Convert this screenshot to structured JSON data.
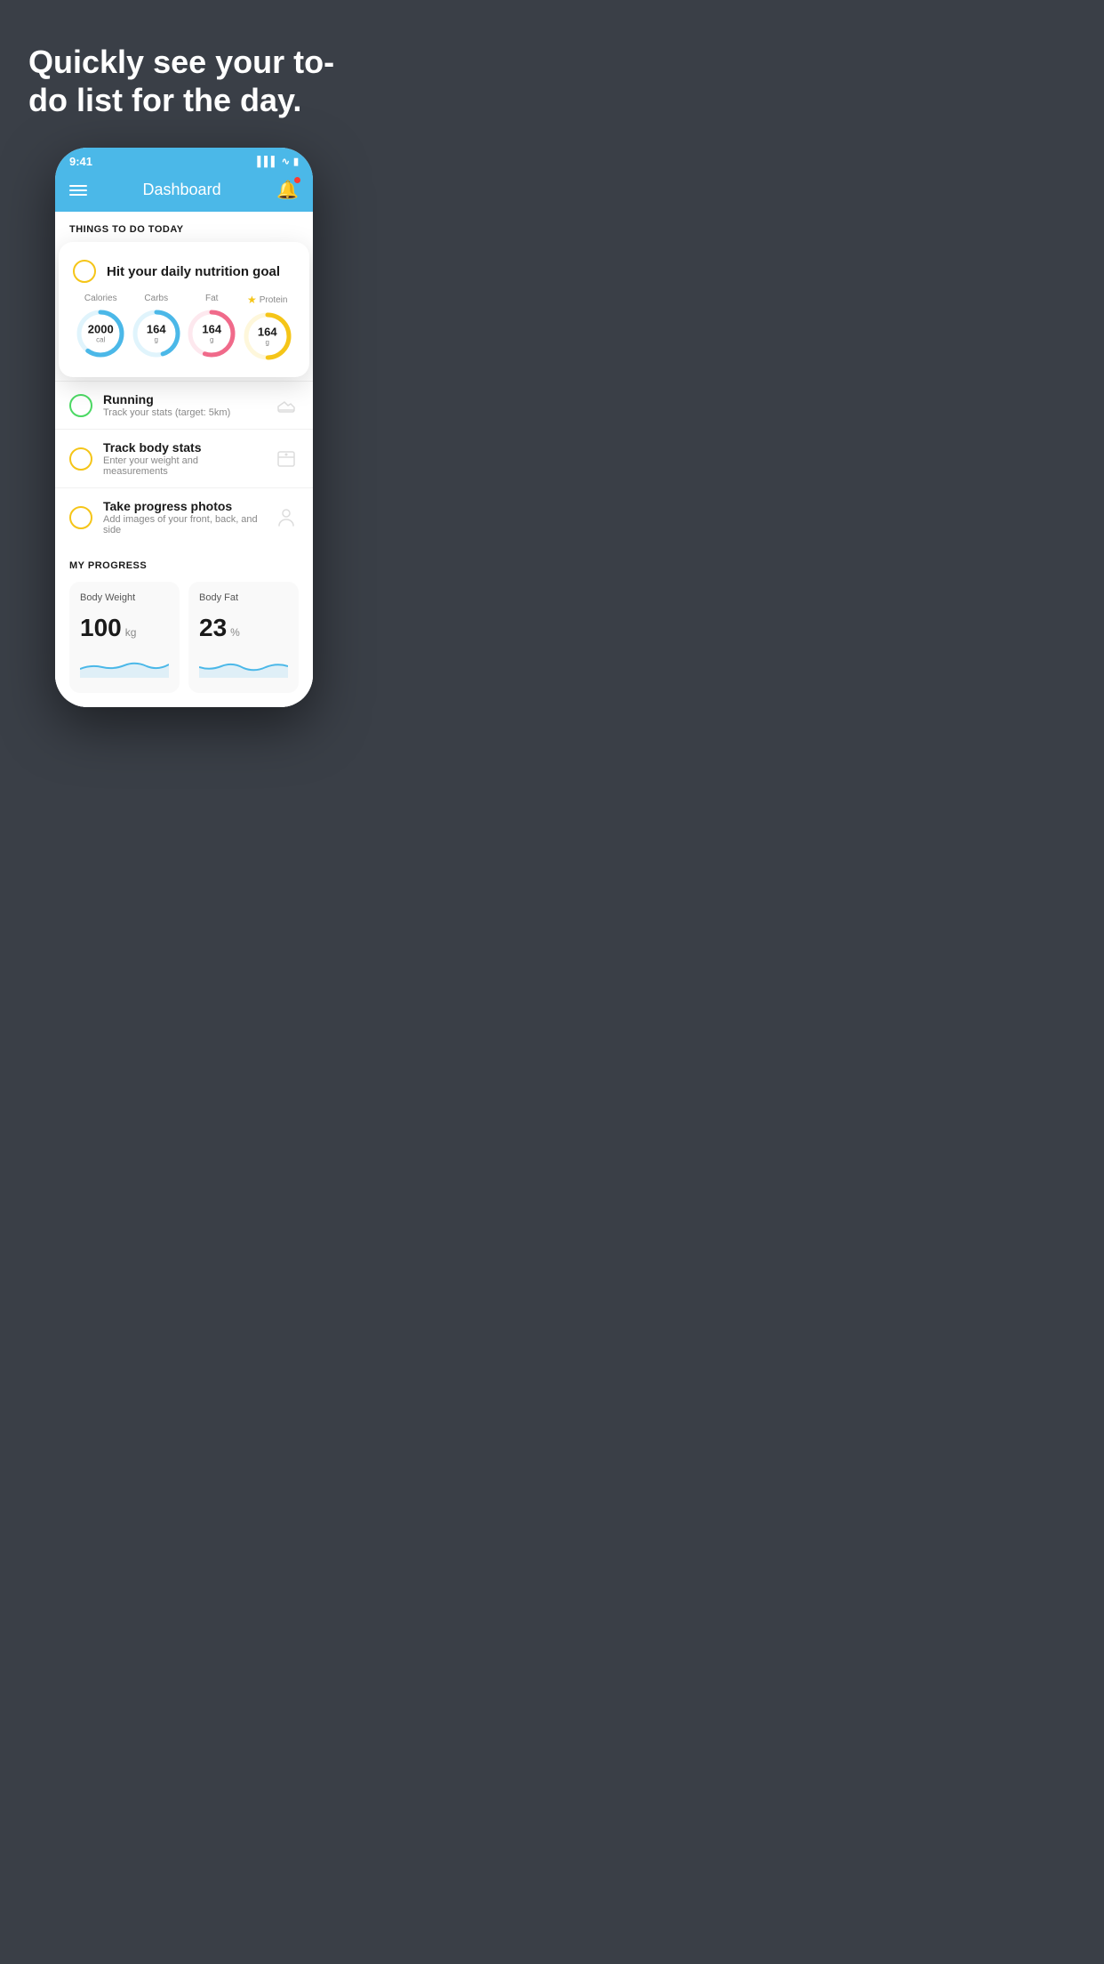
{
  "hero": {
    "title": "Quickly see your to-do list for the day."
  },
  "phone": {
    "status_bar": {
      "time": "9:41",
      "signal_icon": "signal-icon",
      "wifi_icon": "wifi-icon",
      "battery_icon": "battery-icon"
    },
    "nav": {
      "title": "Dashboard",
      "menu_icon": "menu-icon",
      "bell_icon": "bell-icon"
    },
    "things_section": {
      "header": "THINGS TO DO TODAY"
    },
    "nutrition_card": {
      "checkbox_state": "incomplete",
      "title": "Hit your daily nutrition goal",
      "metrics": [
        {
          "label": "Calories",
          "value": "2000",
          "unit": "cal",
          "color": "#4bb8e8",
          "track_color": "#e0f4fc",
          "progress": 60,
          "star": false
        },
        {
          "label": "Carbs",
          "value": "164",
          "unit": "g",
          "color": "#4bb8e8",
          "track_color": "#e0f4fc",
          "progress": 45,
          "star": false
        },
        {
          "label": "Fat",
          "value": "164",
          "unit": "g",
          "color": "#f06a8a",
          "track_color": "#fde8ee",
          "progress": 55,
          "star": false
        },
        {
          "label": "Protein",
          "value": "164",
          "unit": "g",
          "color": "#f5c518",
          "track_color": "#fef7db",
          "progress": 50,
          "star": true
        }
      ]
    },
    "todo_items": [
      {
        "id": "running",
        "title": "Running",
        "subtitle": "Track your stats (target: 5km)",
        "circle_color": "#4cd964",
        "icon": "shoe-icon",
        "icon_char": "👟"
      },
      {
        "id": "body-stats",
        "title": "Track body stats",
        "subtitle": "Enter your weight and measurements",
        "circle_color": "#f5c518",
        "icon": "scale-icon",
        "icon_char": "⚖️"
      },
      {
        "id": "progress-photos",
        "title": "Take progress photos",
        "subtitle": "Add images of your front, back, and side",
        "circle_color": "#f5c518",
        "icon": "camera-icon",
        "icon_char": "👤"
      }
    ],
    "progress_section": {
      "header": "MY PROGRESS",
      "cards": [
        {
          "title": "Body Weight",
          "value": "100",
          "unit": "kg"
        },
        {
          "title": "Body Fat",
          "value": "23",
          "unit": "%"
        }
      ]
    }
  }
}
